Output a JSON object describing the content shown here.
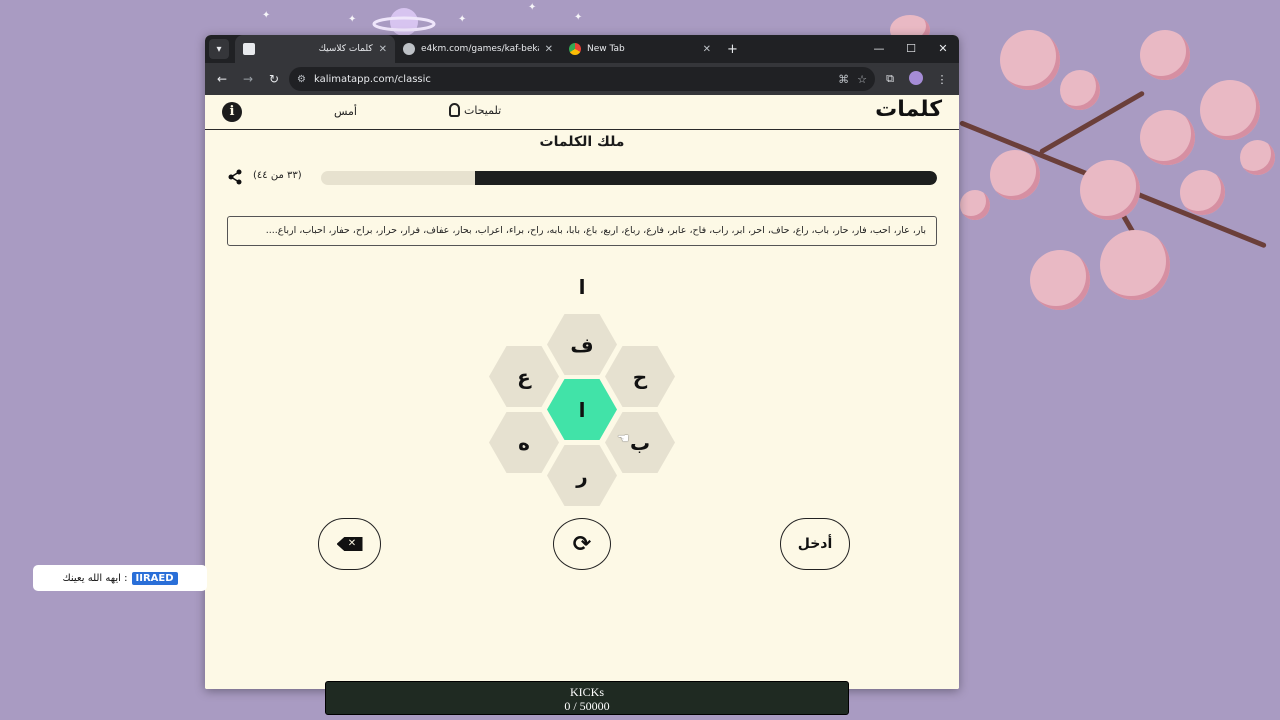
{
  "browser": {
    "tabs": [
      {
        "title": "كلمات كلاسيك",
        "active": true,
        "icon": "kalimat-favicon"
      },
      {
        "title": "e4km.com/games/kaf-bekaf",
        "active": false,
        "icon": "globe-icon"
      },
      {
        "title": "New Tab",
        "active": false,
        "icon": "chrome-icon"
      }
    ],
    "url": "kalimatapp.com/classic"
  },
  "app": {
    "logo": "كلمات",
    "nav": {
      "hints": "تلميحات",
      "yesterday": "أمس"
    },
    "rank": "ملك الكلمات",
    "score_label": "(٣٣ من ٤٤)",
    "progress": 0.75,
    "found_words": "بار، عار، احب، فار، حار، باب، راع، حاف، احر، ابر، راب، فاح، عابر، فارع، رباع، اربع، باع، بابا، بابه، راح، براء، اعراب، بحار، عفاف، فرار، حرار، براح، حفار، احباب، ارباع....",
    "entry": "ا",
    "letters": {
      "center": "ا",
      "top": "ف",
      "top_left": "ع",
      "top_right": "ح",
      "bottom_left": "ه",
      "bottom_right": "ب",
      "bottom": "ر"
    },
    "buttons": {
      "enter": "أدخل"
    },
    "accent_color": "#41e3a8"
  },
  "overlay": {
    "caption_text": "ايهه الله يعينك :",
    "caption_badge": "IIRAED",
    "kicks_title": "KICKs",
    "kicks_value": "0 / 50000"
  }
}
